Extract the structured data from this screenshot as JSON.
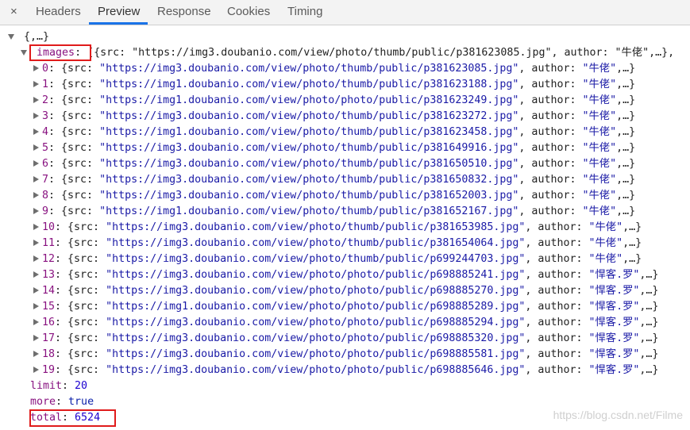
{
  "tabs": {
    "close_glyph": "×",
    "items": [
      {
        "label": "Headers"
      },
      {
        "label": "Preview"
      },
      {
        "label": "Response"
      },
      {
        "label": "Cookies"
      },
      {
        "label": "Timing"
      }
    ],
    "active": "Preview"
  },
  "preview": {
    "root_label": "{,…}",
    "images": {
      "key": "images",
      "summary": "[{src: \"https://img3.doubanio.com/view/photo/thumb/public/p381623085.jpg\", author: \"牛佬\",…},",
      "items": [
        {
          "index": "0",
          "src": "https://img3.doubanio.com/view/photo/thumb/public/p381623085.jpg",
          "author": "牛佬"
        },
        {
          "index": "1",
          "src": "https://img1.doubanio.com/view/photo/thumb/public/p381623188.jpg",
          "author": "牛佬"
        },
        {
          "index": "2",
          "src": "https://img1.doubanio.com/view/photo/photo/public/p381623249.jpg",
          "author": "牛佬"
        },
        {
          "index": "3",
          "src": "https://img3.doubanio.com/view/photo/thumb/public/p381623272.jpg",
          "author": "牛佬"
        },
        {
          "index": "4",
          "src": "https://img1.doubanio.com/view/photo/thumb/public/p381623458.jpg",
          "author": "牛佬"
        },
        {
          "index": "5",
          "src": "https://img3.doubanio.com/view/photo/thumb/public/p381649916.jpg",
          "author": "牛佬"
        },
        {
          "index": "6",
          "src": "https://img3.doubanio.com/view/photo/thumb/public/p381650510.jpg",
          "author": "牛佬"
        },
        {
          "index": "7",
          "src": "https://img3.doubanio.com/view/photo/thumb/public/p381650832.jpg",
          "author": "牛佬"
        },
        {
          "index": "8",
          "src": "https://img3.doubanio.com/view/photo/thumb/public/p381652003.jpg",
          "author": "牛佬"
        },
        {
          "index": "9",
          "src": "https://img1.doubanio.com/view/photo/thumb/public/p381652167.jpg",
          "author": "牛佬"
        },
        {
          "index": "10",
          "src": "https://img3.doubanio.com/view/photo/thumb/public/p381653985.jpg",
          "author": "牛佬"
        },
        {
          "index": "11",
          "src": "https://img3.doubanio.com/view/photo/thumb/public/p381654064.jpg",
          "author": "牛佬"
        },
        {
          "index": "12",
          "src": "https://img3.doubanio.com/view/photo/thumb/public/p699244703.jpg",
          "author": "牛佬"
        },
        {
          "index": "13",
          "src": "https://img3.doubanio.com/view/photo/photo/public/p698885241.jpg",
          "author": "悍客.罗"
        },
        {
          "index": "14",
          "src": "https://img3.doubanio.com/view/photo/photo/public/p698885270.jpg",
          "author": "悍客.罗"
        },
        {
          "index": "15",
          "src": "https://img1.doubanio.com/view/photo/photo/public/p698885289.jpg",
          "author": "悍客.罗"
        },
        {
          "index": "16",
          "src": "https://img3.doubanio.com/view/photo/photo/public/p698885294.jpg",
          "author": "悍客.罗"
        },
        {
          "index": "17",
          "src": "https://img3.doubanio.com/view/photo/photo/public/p698885320.jpg",
          "author": "悍客.罗"
        },
        {
          "index": "18",
          "src": "https://img3.doubanio.com/view/photo/photo/public/p698885581.jpg",
          "author": "悍客.罗"
        },
        {
          "index": "19",
          "src": "https://img3.doubanio.com/view/photo/photo/public/p698885646.jpg",
          "author": "悍客.罗"
        }
      ]
    },
    "limit": {
      "key": "limit",
      "value": "20"
    },
    "more": {
      "key": "more",
      "value": "true"
    },
    "total": {
      "key": "total",
      "value": "6524"
    }
  },
  "watermark": "https://blog.csdn.net/Filme",
  "colors": {
    "key": "#881280",
    "string": "#1a1aa6",
    "highlight_box": "#e01b1b",
    "active_tab_underline": "#1a73e8"
  }
}
